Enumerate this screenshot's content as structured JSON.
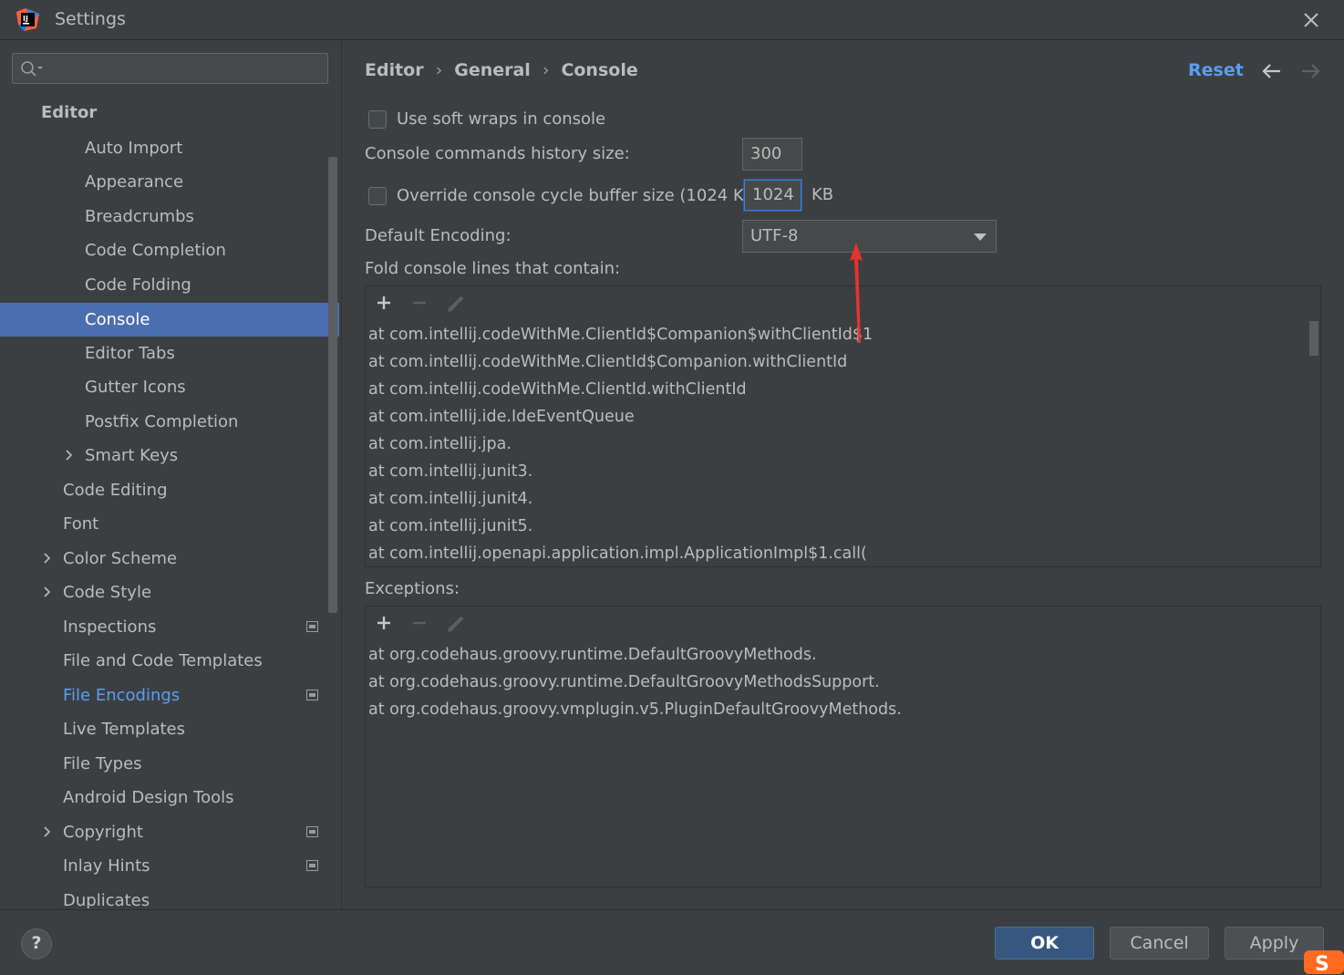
{
  "window": {
    "title": "Settings"
  },
  "sidebar": {
    "search_placeholder": "",
    "items": [
      {
        "label": "Editor"
      },
      {
        "label": "Auto Import"
      },
      {
        "label": "Appearance"
      },
      {
        "label": "Breadcrumbs"
      },
      {
        "label": "Code Completion"
      },
      {
        "label": "Code Folding"
      },
      {
        "label": "Console"
      },
      {
        "label": "Editor Tabs"
      },
      {
        "label": "Gutter Icons"
      },
      {
        "label": "Postfix Completion"
      },
      {
        "label": "Smart Keys"
      },
      {
        "label": "Code Editing"
      },
      {
        "label": "Font"
      },
      {
        "label": "Color Scheme"
      },
      {
        "label": "Code Style"
      },
      {
        "label": "Inspections"
      },
      {
        "label": "File and Code Templates"
      },
      {
        "label": "File Encodings"
      },
      {
        "label": "Live Templates"
      },
      {
        "label": "File Types"
      },
      {
        "label": "Android Design Tools"
      },
      {
        "label": "Copyright"
      },
      {
        "label": "Inlay Hints"
      },
      {
        "label": "Duplicates"
      }
    ]
  },
  "breadcrumb": [
    "Editor",
    "General",
    "Console"
  ],
  "header": {
    "reset_label": "Reset"
  },
  "console": {
    "soft_wraps_label": "Use soft wraps in console",
    "soft_wraps_checked": false,
    "history_label": "Console commands history size:",
    "history_value": "300",
    "override_label": "Override console cycle buffer size (1024 KB)",
    "override_checked": false,
    "buffer_value": "1024",
    "buffer_unit": "KB",
    "encoding_label": "Default Encoding:",
    "encoding_value": "UTF-8",
    "fold_label": "Fold console lines that contain:",
    "fold_lines": [
      "at com.intellij.codeWithMe.ClientId$Companion$withClientId$1",
      "at com.intellij.codeWithMe.ClientId$Companion.withClientId",
      "at com.intellij.codeWithMe.ClientId.withClientId",
      "at com.intellij.ide.IdeEventQueue",
      "at com.intellij.jpa.",
      "at com.intellij.junit3.",
      "at com.intellij.junit4.",
      "at com.intellij.junit5.",
      "at com.intellij.openapi.application.impl.ApplicationImpl$1.call("
    ],
    "exceptions_label": "Exceptions:",
    "exception_lines": [
      "at org.codehaus.groovy.runtime.DefaultGroovyMethods.",
      "at org.codehaus.groovy.runtime.DefaultGroovyMethodsSupport.",
      "at org.codehaus.groovy.vmplugin.v5.PluginDefaultGroovyMethods."
    ]
  },
  "footer": {
    "help_label": "?",
    "ok_label": "OK",
    "cancel_label": "Cancel",
    "apply_label": "Apply"
  },
  "colors": {
    "background": "#3c3f41",
    "selection": "#4b6eaf",
    "link": "#589df6",
    "primary_button": "#365880",
    "annotation_arrow": "#e8322f"
  }
}
